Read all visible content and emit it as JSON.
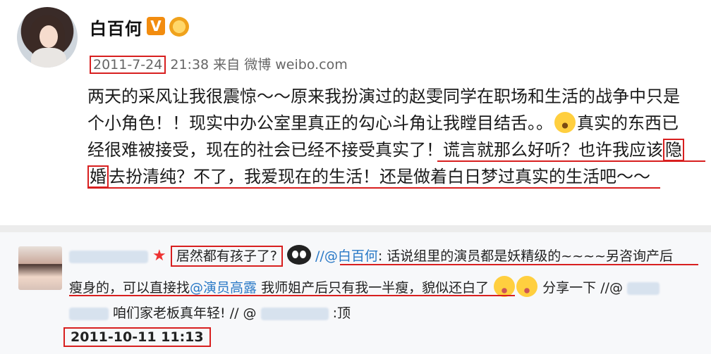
{
  "post": {
    "author": "白百何",
    "badge_v": "V",
    "date": "2011-7-24",
    "time_source": " 21:38 来自 微博 weibo.com",
    "lines": [
      "两天的采风让我很震惊～～原来我扮演过的赵雯同学在职场和生活的战争中只是",
      "个小角色！！现实中办公室里真正的勾心斗角让我瞠目结舌。。",
      "真实的东西已",
      "经很难被接受，现在的社会已经不接受真实了！谎言就那么好听？也许我应该",
      "隐",
      "婚",
      "去扮清纯？不了，我爱现在的生活！还是做着白日梦过真实的生活吧～～"
    ]
  },
  "comment": {
    "boxed_text": "居然都有孩子了?",
    "mention1": "//@白百何",
    "line1_rest": ": 话说组里的演员都是妖精级的~~~~另咨询产后",
    "line2_a": "瘦身的，可以直接找",
    "mention2": "@演员高露",
    "line2_b": " 我师姐产后只有我一半瘦，貌似还白了",
    "line2_c": "分享一下 //@",
    "line3_a": "咱们家老板真年轻! // @",
    "line3_b": ":顶",
    "timestamp": "2011-10-11 11:13"
  },
  "icons": {
    "avatar": "profile-photo",
    "verified": "v-badge-icon",
    "medal": "medal-icon",
    "shock_emoji": "shocked-face-icon",
    "eyes_emoji": "eyes-icon",
    "laugh_emoji": "laughing-face-icon"
  },
  "colors": {
    "highlight_red": "#d81f1f",
    "link_blue": "#2878c6",
    "badge_orange": "#f28c0f"
  }
}
